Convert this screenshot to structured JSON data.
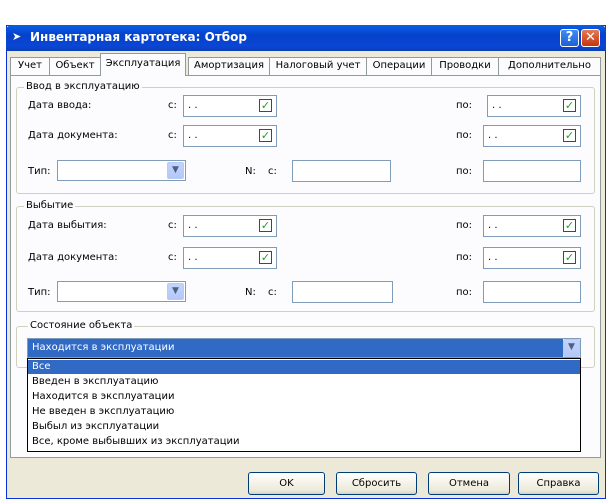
{
  "window": {
    "title": "Инвентарная картотека: Отбор"
  },
  "tabs": [
    "Учет",
    "Объект",
    "Эксплуатация",
    "Амортизация",
    "Налоговый учет",
    "Операции",
    "Проводки",
    "Дополнительно"
  ],
  "intro": {
    "group_title": "Ввод в эксплуатацию",
    "date_input_label": "Дата ввода:",
    "doc_date_label": "Дата документа:",
    "type_label": "Тип:",
    "from_label": "с:",
    "to_label": "по:",
    "number_label": "N:",
    "empty_date": ". .",
    "checkmark": "✓"
  },
  "disposal": {
    "group_title": "Выбытие",
    "date_label": "Дата выбытия:",
    "doc_date_label": "Дата документа:",
    "type_label": "Тип:",
    "from_label": "с:",
    "to_label": "по:",
    "number_label": "N:",
    "empty_date": ". .",
    "checkmark": "✓"
  },
  "state": {
    "group_title": "Состояние объекта",
    "selected": "Находится в эксплуатации",
    "options": [
      "Все",
      "Введен в эксплуатацию",
      "Находится в эксплуатации",
      "Не введен в эксплуатацию",
      "Выбыл из эксплуатации",
      "Все, кроме выбывших из эксплуатации"
    ],
    "highlighted_index": 0
  },
  "buttons": {
    "ok": "OK",
    "reset": "Сбросить",
    "cancel": "Отмена",
    "help": "Справка"
  },
  "icons": {
    "help": "?",
    "close": "✕",
    "dropdown": "▼",
    "title": "➤"
  },
  "colors": {
    "selection": "#316ac5",
    "titlebar": "#0a46d6"
  }
}
